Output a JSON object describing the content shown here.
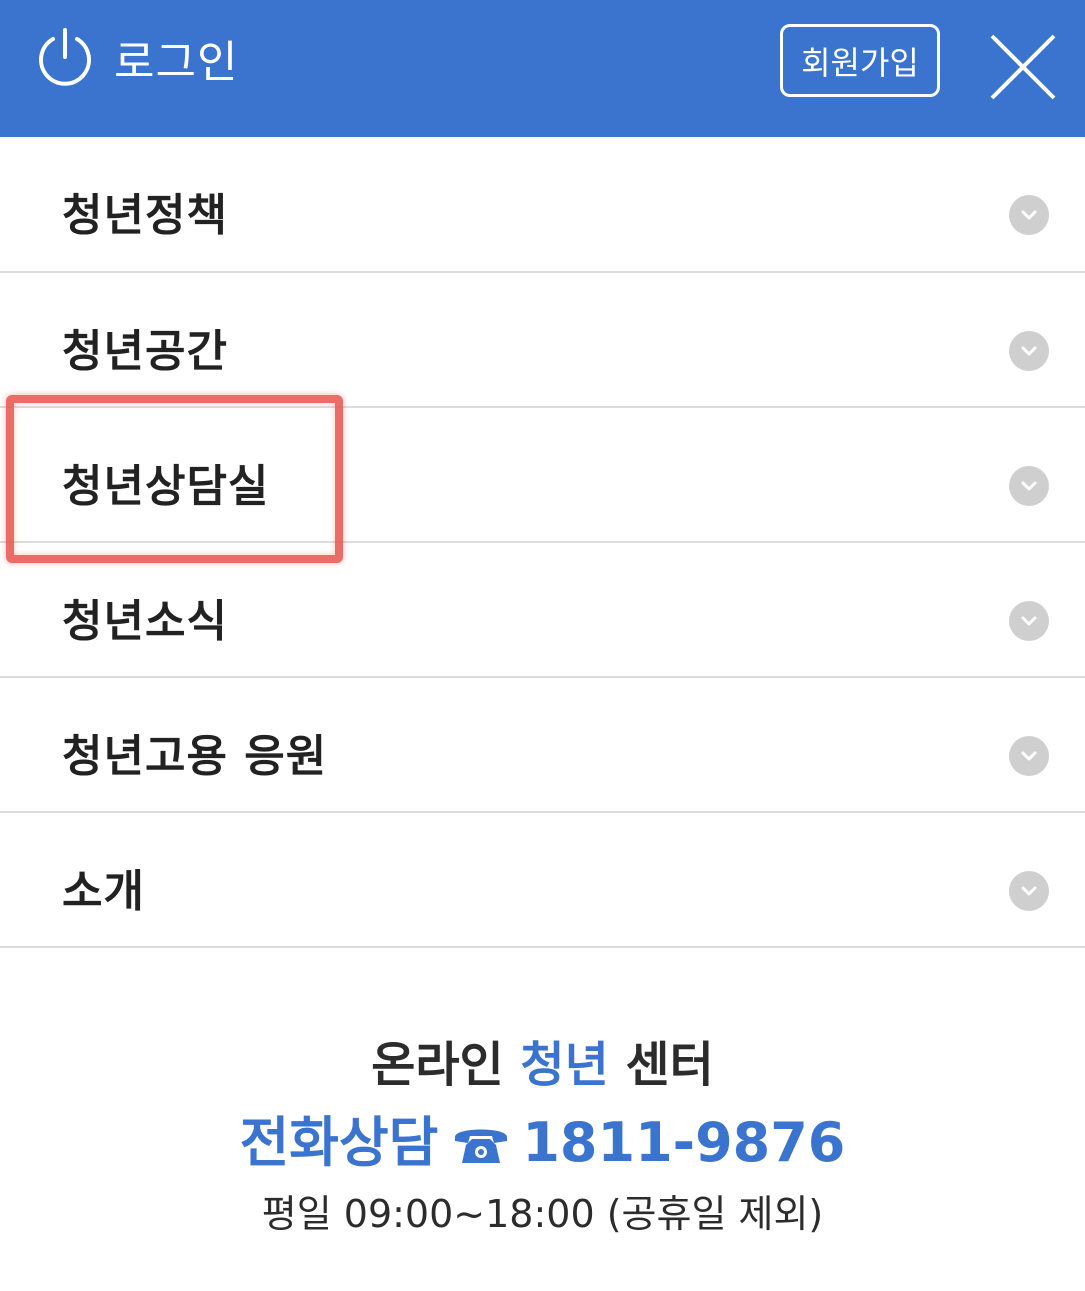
{
  "header": {
    "login_label": "로그인",
    "join_label": "회원가입",
    "accent_color": "#3a74cf"
  },
  "menu": {
    "items": [
      {
        "label": "청년정책",
        "icon": "chevron-down-icon"
      },
      {
        "label": "청년공간",
        "icon": "chevron-down-icon"
      },
      {
        "label": "청년상담실",
        "icon": "chevron-down-icon",
        "highlighted": true
      },
      {
        "label": "청년소식",
        "icon": "chevron-down-icon"
      },
      {
        "label": "청년고용 응원",
        "icon": "chevron-down-icon"
      },
      {
        "label": "소개",
        "icon": "chevron-down-icon"
      }
    ]
  },
  "footer": {
    "center_prefix": "온라인",
    "center_brand": "청년",
    "center_suffix": "센터",
    "phone_label": "전화상담",
    "phone_icon": "telephone-icon",
    "phone_number": "1811-9876",
    "hours": "평일 09:00~18:00 (공휴일 제외)"
  },
  "highlight_color": "#e8554b"
}
